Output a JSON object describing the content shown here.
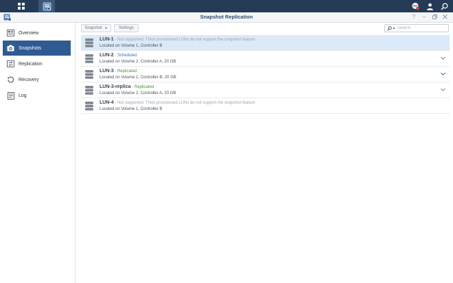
{
  "window": {
    "title": "Snapshot Replication"
  },
  "sidebar": {
    "items": [
      {
        "label": "Overview",
        "icon": "overview-icon"
      },
      {
        "label": "Snapshots",
        "icon": "camera-icon",
        "active": true
      },
      {
        "label": "Replication",
        "icon": "replication-icon"
      },
      {
        "label": "Recovery",
        "icon": "recovery-icon"
      },
      {
        "label": "Log",
        "icon": "log-icon"
      }
    ]
  },
  "toolbar": {
    "snapshot_label": "Snapshot",
    "settings_label": "Settings",
    "search_placeholder": "Search"
  },
  "luns": [
    {
      "name": "LUN-1",
      "separator": " - ",
      "status": "Not supported: Thick provisioned LUNs do not support the snapshot feature",
      "status_type": "neutral",
      "location": "Located on Volume 1, Controller B",
      "selected": true,
      "expandable": false
    },
    {
      "name": "LUN-2",
      "separator": " - ",
      "status": "Scheduled",
      "status_type": "scheduled",
      "location": "Located on Volume 2, Controller A, 20 GB",
      "selected": false,
      "expandable": true
    },
    {
      "name": "LUN-3",
      "separator": " - ",
      "status": "Replicated",
      "status_type": "replicated",
      "location": "Located on Volume 1, Controller B, 20 GB",
      "selected": false,
      "expandable": true
    },
    {
      "name": "LUN-3-replica",
      "separator": " - ",
      "status": "Replicated",
      "status_type": "replicated",
      "location": "Located on Volume 2, Controller A, 20 GB",
      "selected": false,
      "expandable": true
    },
    {
      "name": "LUN-4",
      "separator": " - ",
      "status": "Not supported: Thick provisioned LUNs do not support the snapshot feature",
      "status_type": "neutral",
      "location": "Located on Volume 1, Controller B",
      "selected": false,
      "expandable": false
    }
  ],
  "colors": {
    "taskbar": "#243a55",
    "accent": "#2f5b93",
    "selected_row": "#dbe9f8",
    "scheduled": "#2f6fb5",
    "replicated": "#3f9a2c"
  }
}
